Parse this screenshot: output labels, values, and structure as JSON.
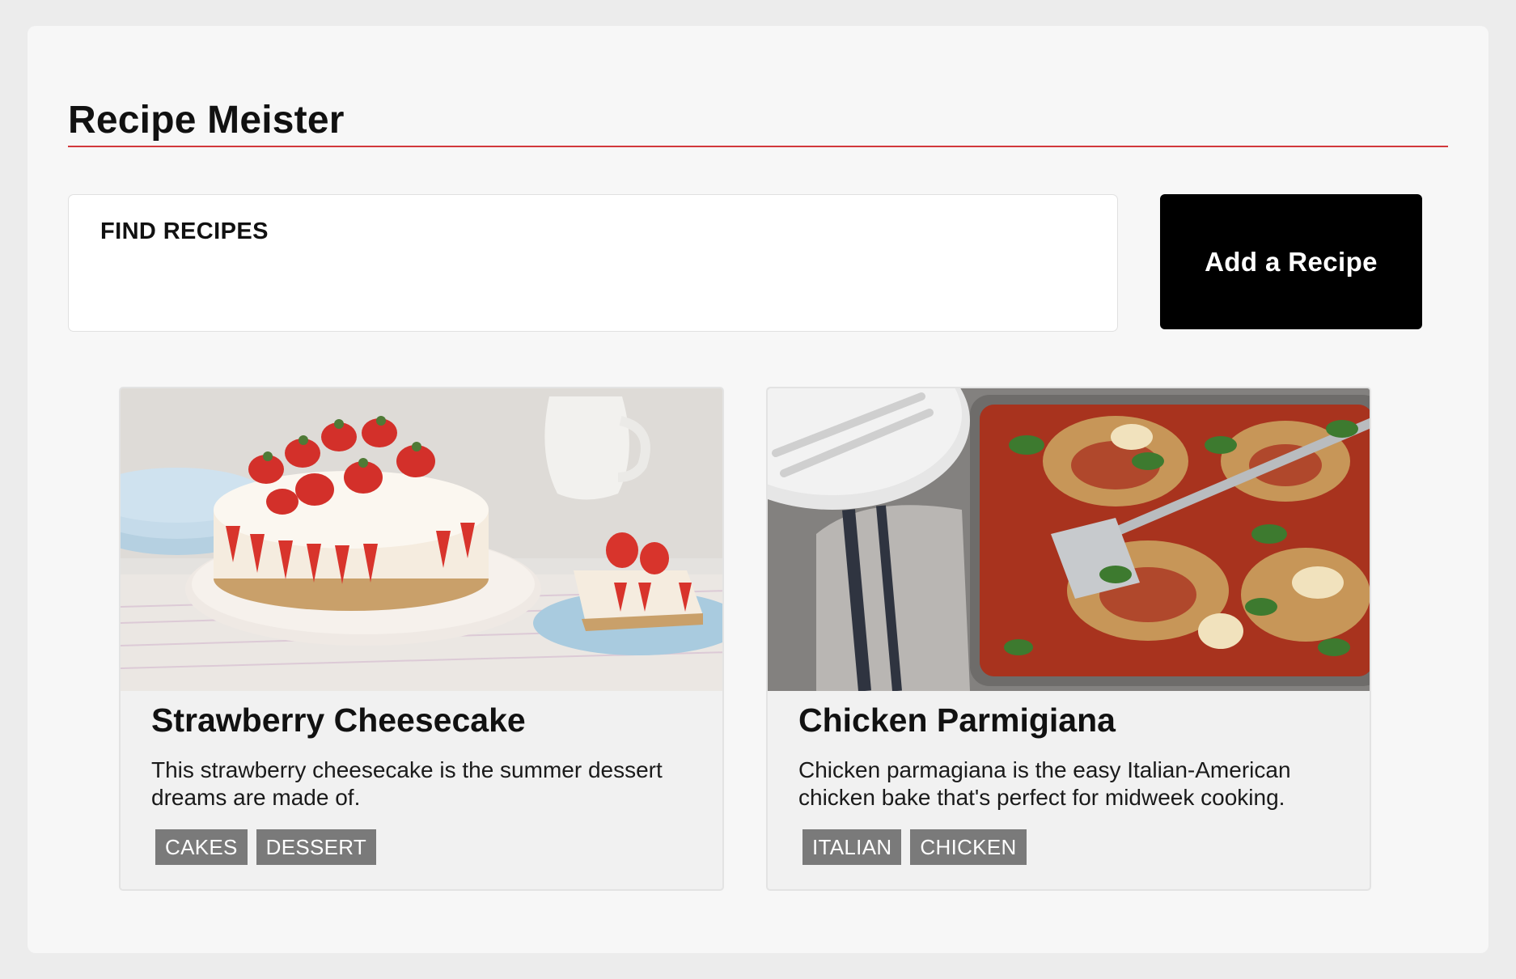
{
  "app": {
    "title": "Recipe Meister",
    "accent_color": "#d2393c"
  },
  "search": {
    "label": "FIND RECIPES",
    "value": "",
    "placeholder": ""
  },
  "actions": {
    "add_label": "Add a Recipe"
  },
  "recipes": [
    {
      "title": "Strawberry Cheesecake",
      "description": "This strawberry cheesecake is the summer dessert dreams are made of.",
      "tags": [
        "CAKES",
        "DESSERT"
      ],
      "image": "strawberry-cheesecake-photo"
    },
    {
      "title": "Chicken Parmigiana",
      "description": "Chicken parmagiana is the easy Italian-American chicken bake that's perfect for midweek cooking.",
      "tags": [
        "ITALIAN",
        "CHICKEN"
      ],
      "image": "chicken-parmigiana-photo"
    }
  ]
}
